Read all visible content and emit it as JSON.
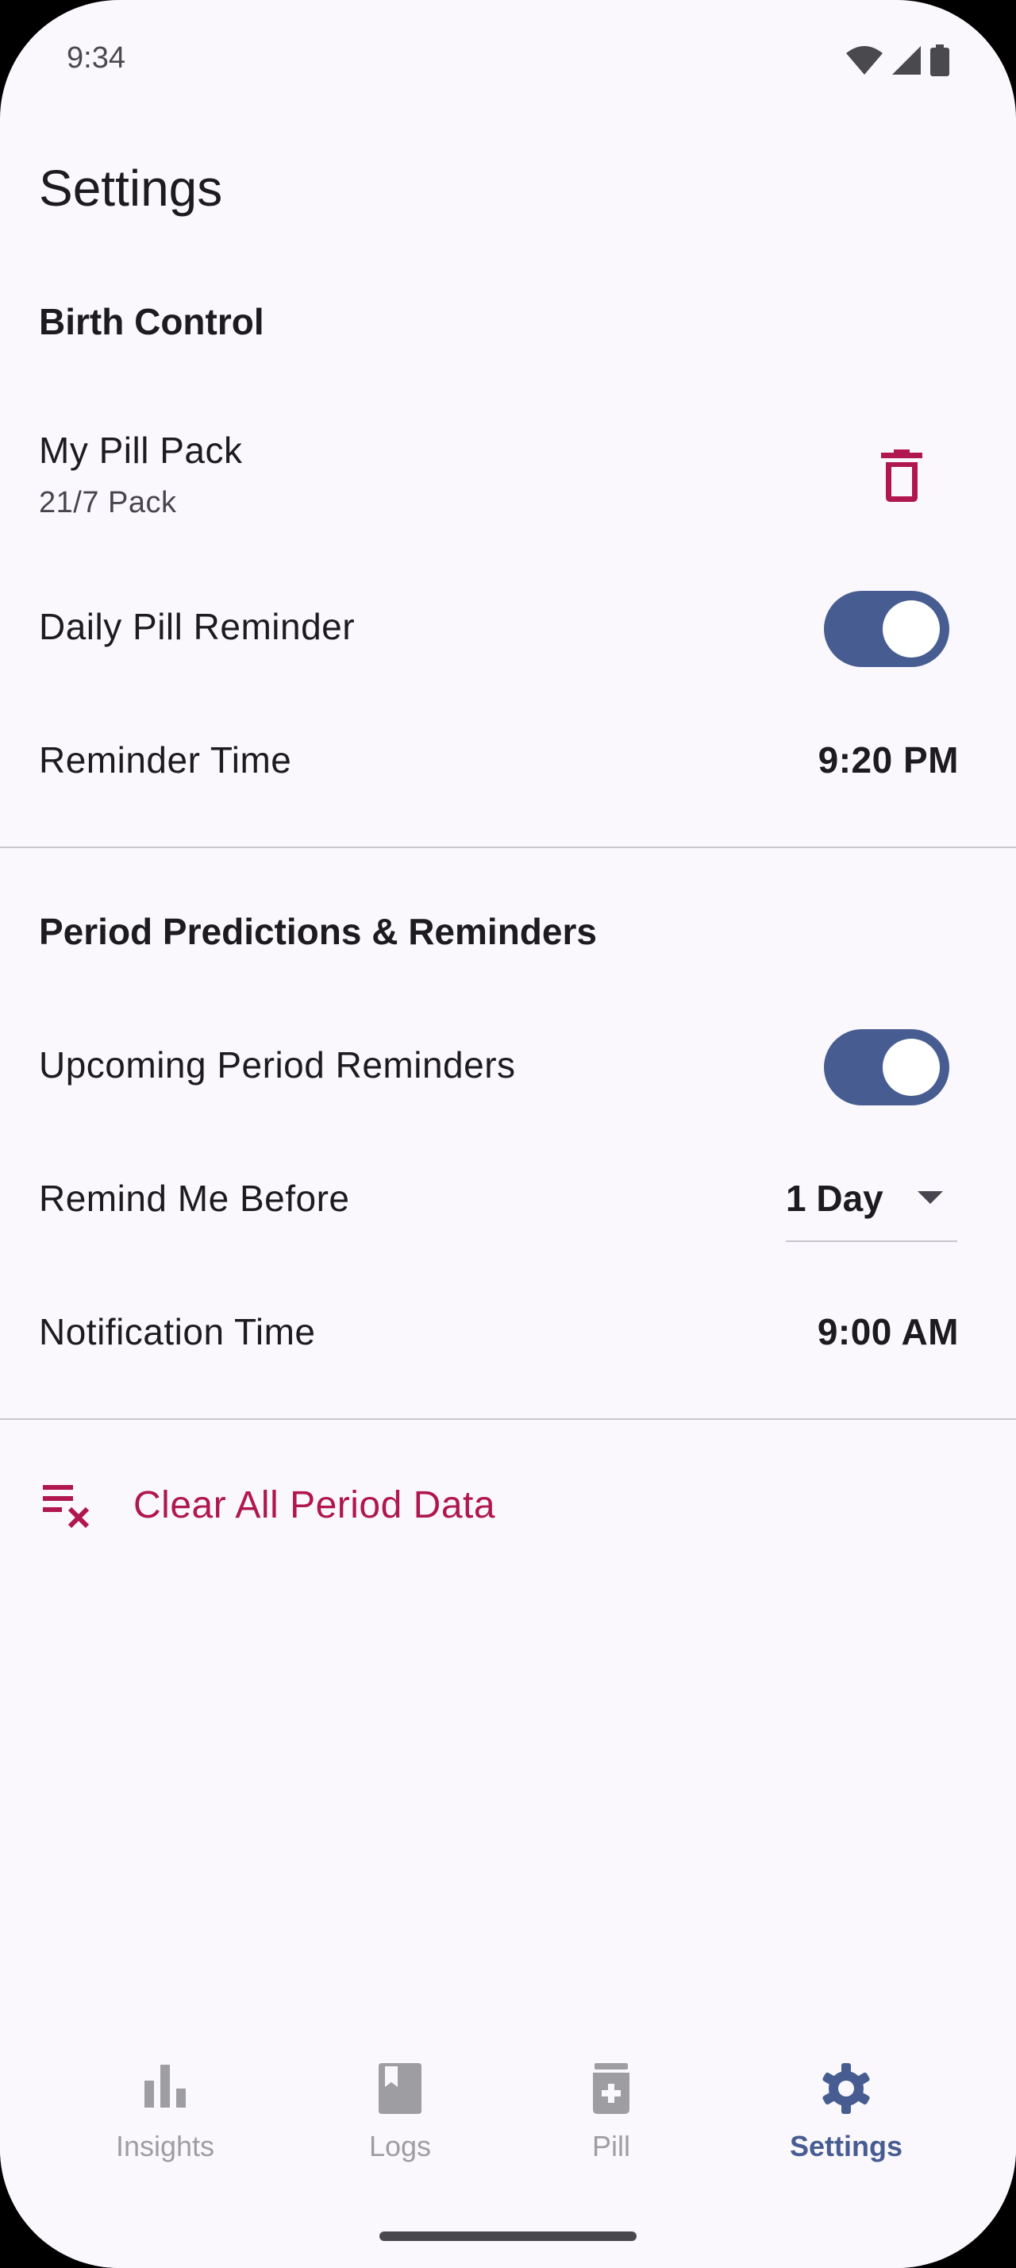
{
  "status_bar": {
    "time": "9:34",
    "icons": [
      "wifi-icon",
      "signal-icon",
      "battery-icon"
    ]
  },
  "page": {
    "title": "Settings"
  },
  "birth_control": {
    "section_title": "Birth Control",
    "pill_pack": {
      "label": "My Pill Pack",
      "subtitle": "21/7 Pack",
      "action_icon": "trash-icon"
    },
    "daily_reminder": {
      "label": "Daily Pill Reminder",
      "enabled": true
    },
    "reminder_time": {
      "label": "Reminder Time",
      "value": "9:20 PM"
    }
  },
  "period": {
    "section_title": "Period Predictions & Reminders",
    "upcoming_reminders": {
      "label": "Upcoming Period Reminders",
      "enabled": true
    },
    "remind_before": {
      "label": "Remind Me Before",
      "value": "1 Day"
    },
    "notification_time": {
      "label": "Notification Time",
      "value": "9:00 AM"
    }
  },
  "clear": {
    "label": "Clear All Period Data",
    "icon": "clear-list-icon"
  },
  "bottom_nav": {
    "items": [
      {
        "label": "Insights",
        "icon": "bar-chart-icon",
        "active": false
      },
      {
        "label": "Logs",
        "icon": "bookmark-book-icon",
        "active": false
      },
      {
        "label": "Pill",
        "icon": "pill-bottle-icon",
        "active": false
      },
      {
        "label": "Settings",
        "icon": "gear-icon",
        "active": true
      }
    ]
  },
  "colors": {
    "background": "#fbf8fd",
    "accent": "#475d92",
    "danger": "#b0174f",
    "text": "#1c1b1f",
    "inactive": "#9e9ea2"
  }
}
